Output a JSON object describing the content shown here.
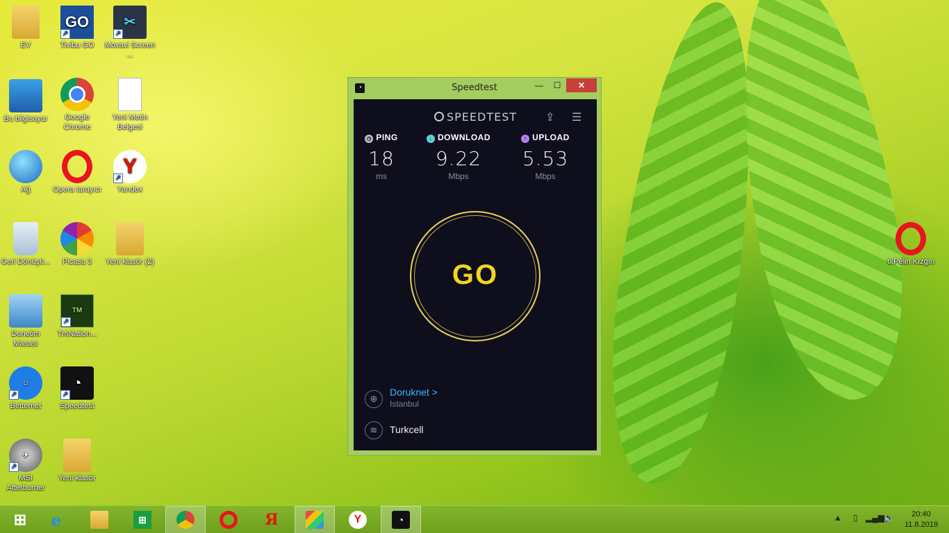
{
  "desktop": {
    "icons": [
      {
        "label": "EV",
        "icon": "user-folder-icon",
        "glyph": ""
      },
      {
        "label": "Bu bilgisayar",
        "icon": "computer-icon",
        "glyph": ""
      },
      {
        "label": "Ağ",
        "icon": "network-icon",
        "glyph": ""
      },
      {
        "label": "Geri Dönüşü...",
        "icon": "recycle-bin-icon",
        "glyph": ""
      },
      {
        "label": "Denetim Masası",
        "icon": "control-panel-icon",
        "glyph": ""
      },
      {
        "label": "Betternet",
        "icon": "betternet-icon",
        "glyph": "☺"
      },
      {
        "label": "MSI Afterburner",
        "icon": "afterburner-icon",
        "glyph": "✈"
      },
      {
        "label": "Tivibu GO",
        "icon": "tivibu-go-icon",
        "glyph": "GO"
      },
      {
        "label": "Google Chrome",
        "icon": "chrome-icon",
        "glyph": ""
      },
      {
        "label": "Opera tarayıcı",
        "icon": "opera-icon",
        "glyph": ""
      },
      {
        "label": "Picasa 3",
        "icon": "picasa-icon",
        "glyph": ""
      },
      {
        "label": "TmNation...",
        "icon": "tmnation-icon",
        "glyph": "TM"
      },
      {
        "label": "Speedtest",
        "icon": "speedtest-icon",
        "glyph": "◔"
      },
      {
        "label": "Yeni klasör",
        "icon": "folder-icon",
        "glyph": ""
      },
      {
        "label": "Movavi Screen ...",
        "icon": "movavi-icon",
        "glyph": "✂"
      },
      {
        "label": "Yeni Metin Belgesi",
        "icon": "text-document-icon",
        "glyph": ""
      },
      {
        "label": "Yandex",
        "icon": "yandex-icon",
        "glyph": "Y"
      },
      {
        "label": "Yeni klasör (2)",
        "icon": "folder-icon",
        "glyph": ""
      },
      {
        "label": "6:Pelin Kızgın",
        "icon": "opera-icon",
        "glyph": ""
      }
    ]
  },
  "window": {
    "title": "Speedtest",
    "minimize_glyph": "—",
    "maximize_glyph": "☐",
    "close_glyph": "✕"
  },
  "speedtest": {
    "logo": "SPEEDTEST",
    "share_glyph": "⇪",
    "settings_glyph": "☰",
    "ping": {
      "label": "PING",
      "value": "18",
      "unit": "ms",
      "icon_glyph": "◷",
      "color": "#bfbfc9"
    },
    "download": {
      "label": "DOWNLOAD",
      "value": "9.22",
      "unit": "Mbps",
      "icon_glyph": "↓",
      "color": "#5fd0d4"
    },
    "upload": {
      "label": "UPLOAD",
      "value": "5.53",
      "unit": "Mbps",
      "icon_glyph": "↑",
      "color": "#b57cf0"
    },
    "go_label": "GO",
    "server": {
      "name": "Doruknet",
      "chevron": ">",
      "location": "Istanbul",
      "icon_glyph": "⊕"
    },
    "isp": {
      "name": "Turkcell",
      "icon_glyph": "≋"
    },
    "accent": "#f3d61d"
  },
  "taskbar": {
    "start_glyph": "⊞",
    "items": [
      {
        "name": "internet-explorer",
        "glyph": "e"
      },
      {
        "name": "file-explorer",
        "glyph": ""
      },
      {
        "name": "store",
        "glyph": "⊞"
      },
      {
        "name": "chrome",
        "glyph": ""
      },
      {
        "name": "opera",
        "glyph": ""
      },
      {
        "name": "yandex-browser",
        "glyph": "Я"
      },
      {
        "name": "bluestacks",
        "glyph": ""
      },
      {
        "name": "yandex",
        "glyph": "Y"
      },
      {
        "name": "speedtest",
        "glyph": "◔"
      }
    ],
    "tray": {
      "arrow": "▲",
      "phone": "▯",
      "signal": "▂▄▆",
      "volume": "🔈"
    },
    "clock": {
      "time": "20:40",
      "date": "11.8.2019"
    }
  }
}
